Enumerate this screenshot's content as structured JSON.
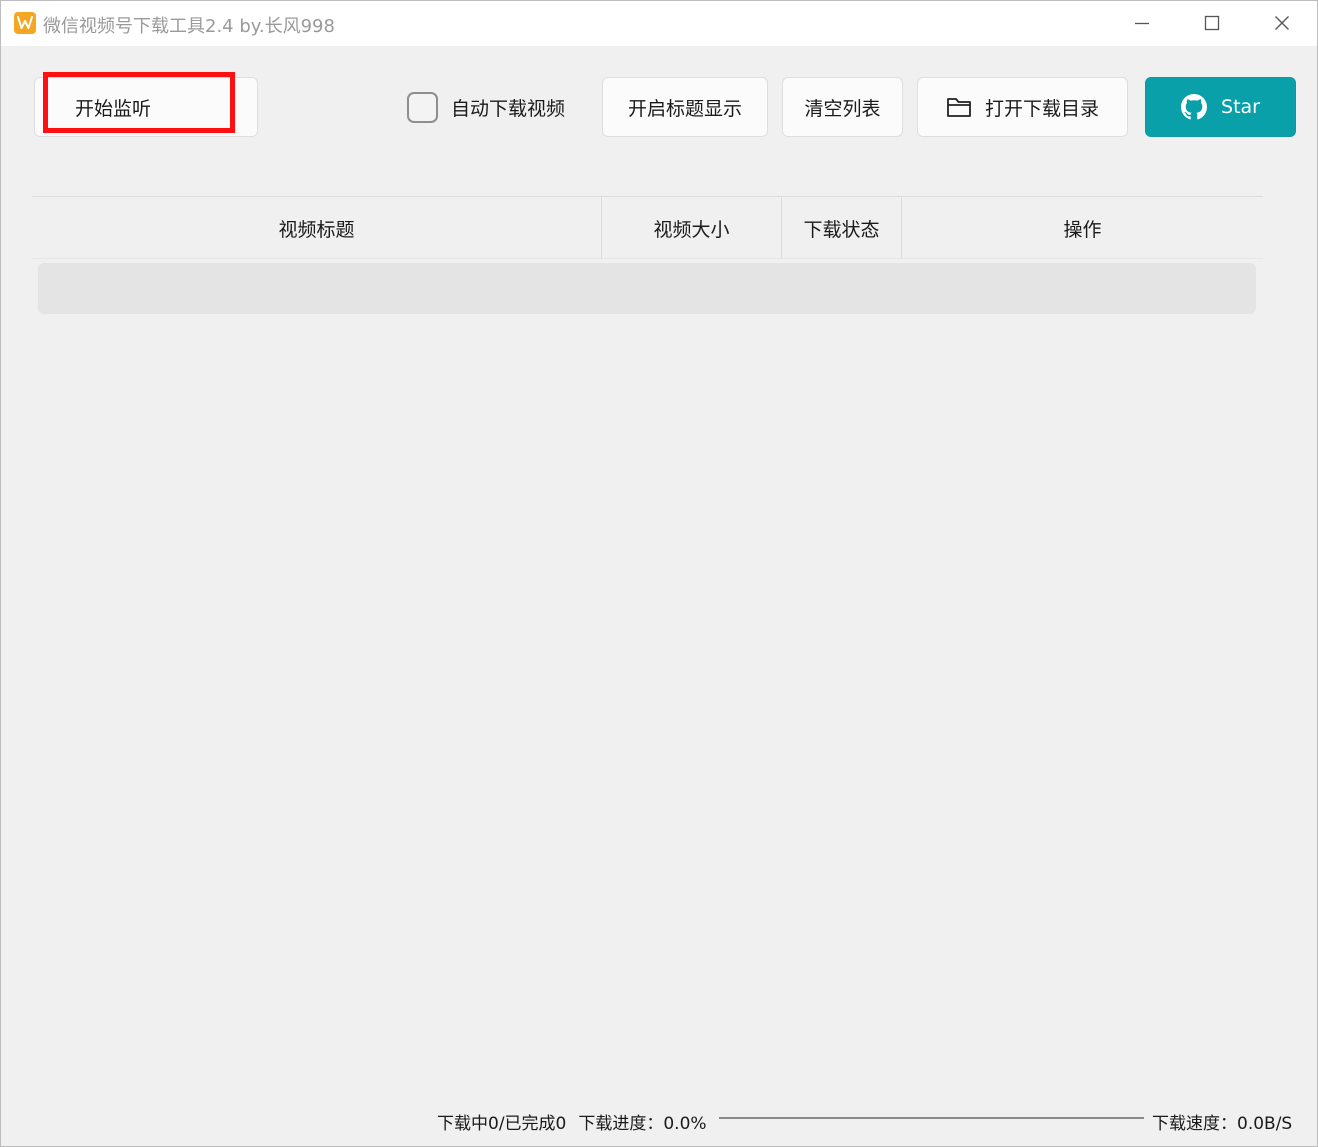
{
  "window": {
    "title": "微信视频号下载工具2.4 by.长风998"
  },
  "toolbar": {
    "start_label": "开始监听",
    "auto_download_label": "自动下载视频",
    "auto_download_checked": false,
    "show_title_label": "开启标题显示",
    "clear_label": "清空列表",
    "open_dir_label": "打开下载目录",
    "star_label": "Star",
    "star_color": "#0aa0aa",
    "highlight_color": "#ff1010"
  },
  "table": {
    "columns": [
      "视频标题",
      "视频大小",
      "下载状态",
      "操作"
    ],
    "rows": []
  },
  "status": {
    "downloading": "下载中0/已完成0",
    "progress_label": "下载进度：0.0%",
    "progress_value": 0.0,
    "speed_label": "下载速度：0.0B/S"
  },
  "icons": {
    "app": "wechat-channels-logo-icon",
    "folder": "folder-icon",
    "github": "github-icon"
  }
}
